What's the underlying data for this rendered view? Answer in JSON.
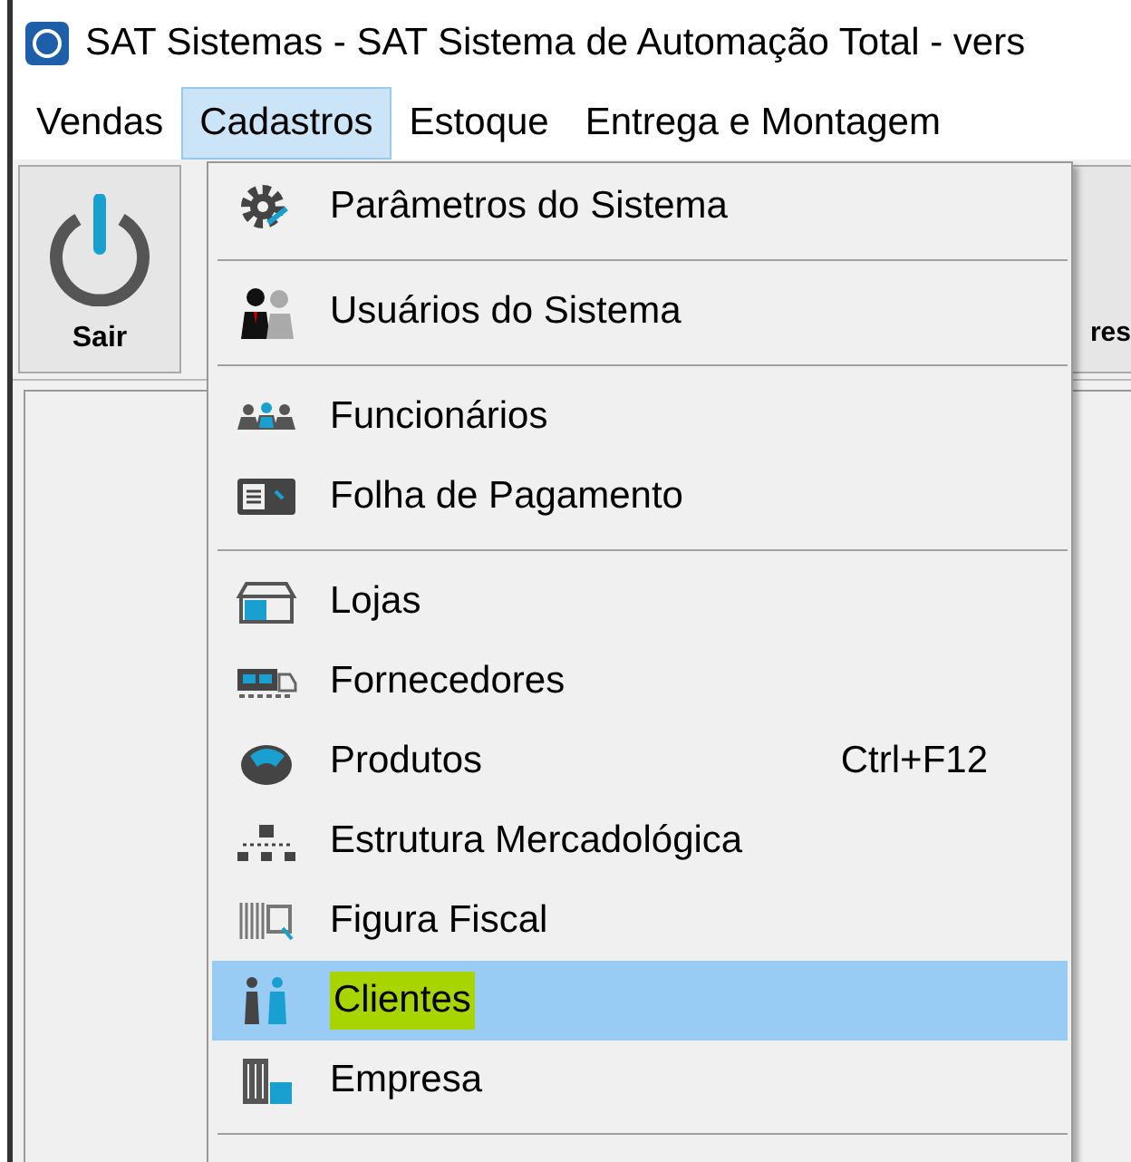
{
  "window": {
    "title": "SAT Sistemas - SAT Sistema de Automação Total - vers"
  },
  "menubar": [
    {
      "label": "Vendas",
      "selected": false
    },
    {
      "label": "Cadastros",
      "selected": true
    },
    {
      "label": "Estoque",
      "selected": false
    },
    {
      "label": "Entrega e Montagem",
      "selected": false
    }
  ],
  "toolbar": [
    {
      "label": "Sair",
      "kind": "power"
    },
    {
      "label": "res",
      "kind": "partial"
    }
  ],
  "menu": [
    {
      "kind": "item",
      "label": "Parâmetros do Sistema",
      "selected": false
    },
    {
      "kind": "separator"
    },
    {
      "kind": "item",
      "label": "Usuários do Sistema",
      "selected": false
    },
    {
      "kind": "separator"
    },
    {
      "kind": "item",
      "label": "Funcionários",
      "selected": false
    },
    {
      "kind": "item",
      "label": "Folha de Pagamento",
      "selected": false
    },
    {
      "kind": "separator"
    },
    {
      "kind": "item",
      "label": "Lojas",
      "selected": false
    },
    {
      "kind": "item",
      "label": "Fornecedores",
      "selected": false
    },
    {
      "kind": "item",
      "label": "Produtos",
      "shortcut": "Ctrl+F12",
      "selected": false
    },
    {
      "kind": "item",
      "label": "Estrutura Mercadológica",
      "selected": false
    },
    {
      "kind": "item",
      "label": "Figura Fiscal",
      "selected": false
    },
    {
      "kind": "item",
      "label": "Clientes",
      "selected": true,
      "marked": true
    },
    {
      "kind": "item",
      "label": "Empresa",
      "selected": false
    },
    {
      "kind": "separator"
    }
  ]
}
